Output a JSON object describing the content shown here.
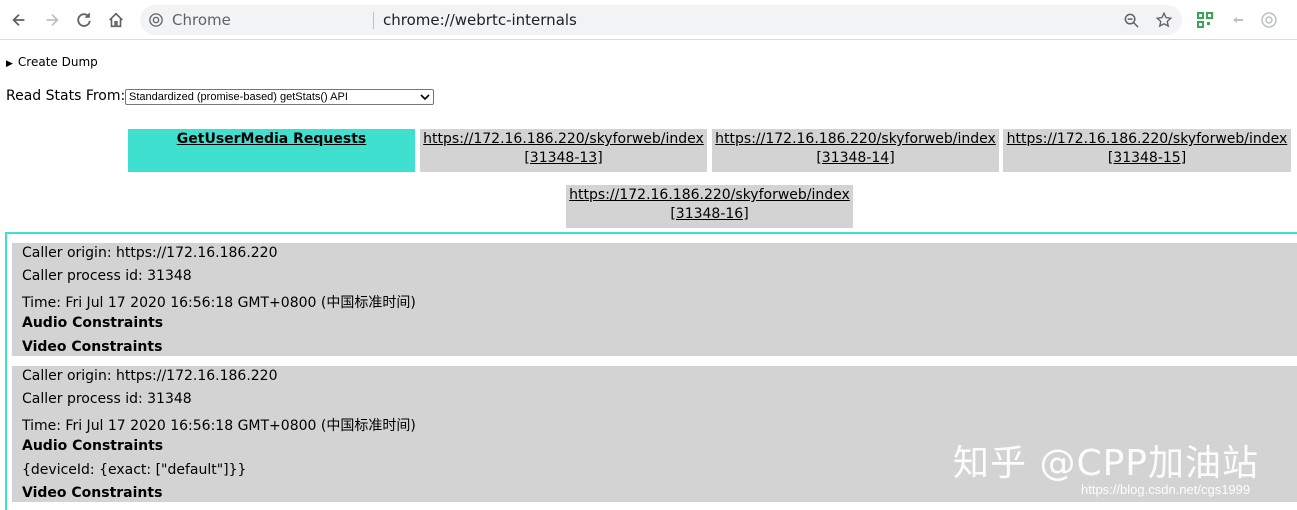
{
  "browser": {
    "scheme_label": "Chrome",
    "url": "chrome://webrtc-internals",
    "icons": [
      "back-icon",
      "forward-icon",
      "reload-icon",
      "home-icon",
      "chrome-logo-icon",
      "zoom-icon",
      "star-icon",
      "extension-icon"
    ]
  },
  "page": {
    "create_dump": "Create Dump",
    "read_stats_label": "Read Stats From:",
    "read_stats_value": "Standardized (promise-based) getStats() API"
  },
  "tabs": [
    {
      "line1": "GetUserMedia Requests",
      "line2": "",
      "selected": true
    },
    {
      "line1": "https://172.16.186.220/skyforweb/index",
      "line2": "[31348-13]",
      "selected": false
    },
    {
      "line1": "https://172.16.186.220/skyforweb/index",
      "line2": "[31348-14]",
      "selected": false
    },
    {
      "line1": "https://172.16.186.220/skyforweb/index",
      "line2": "[31348-15]",
      "selected": false
    },
    {
      "line1": "https://172.16.186.220/skyforweb/index",
      "line2": "[31348-16]",
      "selected": false
    }
  ],
  "requests": [
    {
      "origin": "Caller origin: https://172.16.186.220",
      "pid": "Caller process id: 31348",
      "time": "Time: Fri Jul 17 2020 16:56:18 GMT+0800 (中国标准时间)",
      "audio_title": "Audio Constraints",
      "audio_value": "",
      "video_title": "Video Constraints"
    },
    {
      "origin": "Caller origin: https://172.16.186.220",
      "pid": "Caller process id: 31348",
      "time": "Time: Fri Jul 17 2020 16:56:18 GMT+0800 (中国标准时间)",
      "audio_title": "Audio Constraints",
      "audio_value": "{deviceId: {exact: [\"default\"]}}",
      "video_title": "Video Constraints"
    }
  ],
  "watermark": "知乎 @CPP加油站",
  "csdn_watermark": "https://blog.csdn.net/cgs1999",
  "colors": {
    "selected_tab": "#40e0d0",
    "tab": "#d3d3d3",
    "border": "#40e0d0"
  }
}
